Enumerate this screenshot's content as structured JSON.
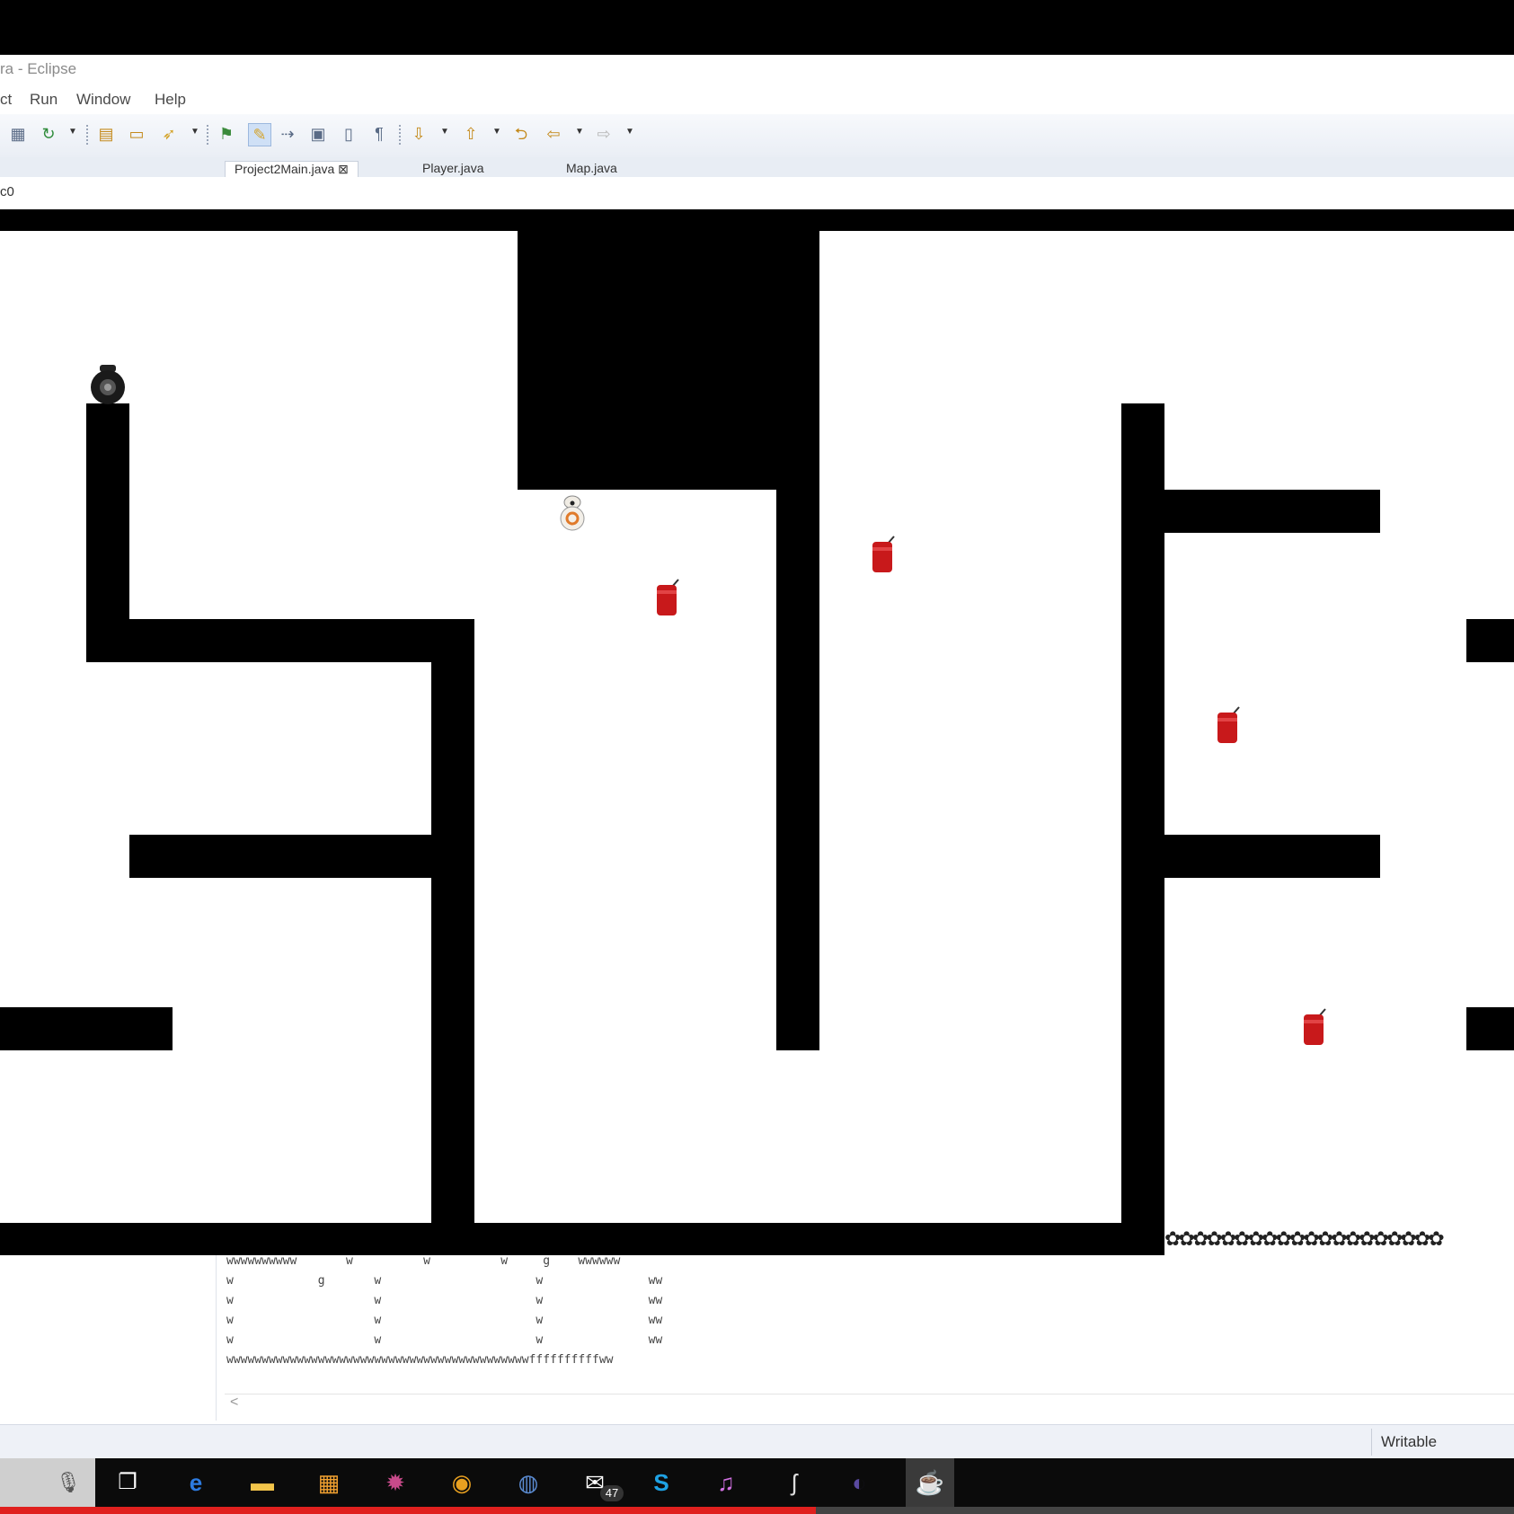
{
  "window": {
    "title": "ra - Eclipse"
  },
  "menu": {
    "items": [
      "ct",
      "Run",
      "Window",
      "Help"
    ]
  },
  "tabs": [
    "Project2Main.java",
    "Player.java",
    "Map.java"
  ],
  "subbar": {
    "label": "c0"
  },
  "game": {
    "finish_pattern": "✿✿✿✿✿✿✿✿✿✿✿✿✿✿✿✿✿✿✿✿"
  },
  "console": {
    "lines": [
      "wwwwwwwwww       w          w          w     g    wwwwww",
      "w            g       w                      w               ww",
      "w                    w                      w               ww",
      "w                    w                      w               ww",
      "w                    w                      w               ww",
      "wwwwwwwwwwwwwwwwwwwwwwwwwwwwwwwwwwwwwwwwwwwffffffffffww"
    ],
    "scroll_arrow": "<"
  },
  "status": {
    "writable": "Writable"
  },
  "taskbar": {
    "mail_badge": "47"
  }
}
